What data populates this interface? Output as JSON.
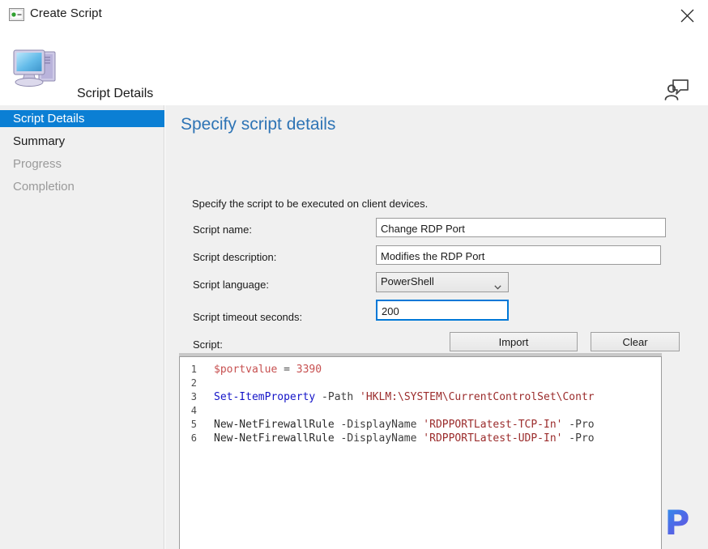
{
  "window": {
    "title": "Create Script",
    "icon": "script-console-icon",
    "close_label": "✕"
  },
  "header": {
    "title": "Script Details",
    "icon": "computer-workstation-icon",
    "help_icon": "presenter-help-icon"
  },
  "sidebar": {
    "items": [
      {
        "label": "Script Details",
        "state": "selected"
      },
      {
        "label": "Summary",
        "state": "active"
      },
      {
        "label": "Progress",
        "state": "disabled"
      },
      {
        "label": "Completion",
        "state": "disabled"
      }
    ]
  },
  "content": {
    "title": "Specify script details",
    "intro": "Specify the script to be executed on client devices.",
    "fields": {
      "script_name": {
        "label": "Script name:",
        "value": "Change RDP Port",
        "placeholder": ""
      },
      "script_description": {
        "label": "Script description:",
        "value": "Modifies the RDP Port",
        "placeholder": ""
      },
      "script_language": {
        "label": "Script language:",
        "value": "PowerShell",
        "options": [
          "PowerShell"
        ]
      },
      "script_timeout": {
        "label": "Script timeout seconds:",
        "value": "200",
        "placeholder": "",
        "focused": true
      },
      "script": {
        "label": "Script:"
      }
    },
    "buttons": {
      "import": "Import",
      "clear": "Clear"
    }
  },
  "editor": {
    "line_numbers": [
      "1",
      "2",
      "3",
      "4",
      "5",
      "6"
    ],
    "lines": [
      [
        {
          "t": "$portvalue",
          "c": "tok-var"
        },
        {
          "t": " = ",
          "c": "tok-op"
        },
        {
          "t": "3390",
          "c": "tok-num"
        }
      ],
      [],
      [
        {
          "t": "Set-ItemProperty",
          "c": "tok-cmd"
        },
        {
          "t": " -Path ",
          "c": "tok-parm"
        },
        {
          "t": "'HKLM:\\SYSTEM\\CurrentControlSet\\Contr",
          "c": "tok-str"
        }
      ],
      [],
      [
        {
          "t": "New-NetFirewallRule",
          "c": "tok-plain"
        },
        {
          "t": " -DisplayName ",
          "c": "tok-parm"
        },
        {
          "t": "'RDPPORTLatest-TCP-In'",
          "c": "tok-str"
        },
        {
          "t": " -Pro",
          "c": "tok-parm"
        }
      ],
      [
        {
          "t": "New-NetFirewallRule",
          "c": "tok-plain"
        },
        {
          "t": " -DisplayName ",
          "c": "tok-parm"
        },
        {
          "t": "'RDPPORTLatest-UDP-In'",
          "c": "tok-str"
        },
        {
          "t": " -Pro",
          "c": "tok-parm"
        }
      ]
    ]
  },
  "watermark": {
    "letter": "P"
  },
  "colors": {
    "accent_selection": "#0b7fd4",
    "heading": "#2e74b5",
    "focus_border": "#0078d7",
    "panel_bg": "#f0f0f0",
    "string_token": "#9b2c2c",
    "cmdlet_token": "#1414c8",
    "variable_token": "#c75050"
  }
}
